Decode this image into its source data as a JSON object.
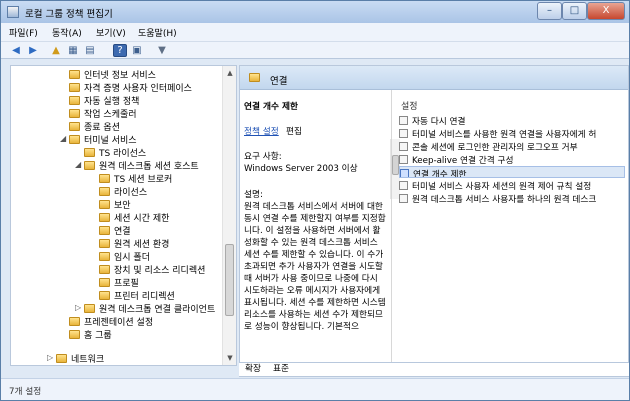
{
  "window": {
    "title": "로컬 그룹 정책 편집기",
    "controls": {
      "minimize": "–",
      "maximize": "□",
      "close": "X"
    }
  },
  "menu": [
    "파일(F)",
    "동작(A)",
    "보기(V)",
    "도움말(H)"
  ],
  "toolbar": {
    "back": "◀",
    "forward": "▶",
    "up": "▲",
    "show_hide": "▦",
    "properties": "▤",
    "help": "?",
    "view": "▣",
    "filter": "▼"
  },
  "tree": [
    {
      "label": "인터넷 정보 서비스",
      "expander": ""
    },
    {
      "label": "자격 증명 사용자 인터페이스",
      "expander": ""
    },
    {
      "label": "자동 실행 정책",
      "expander": ""
    },
    {
      "label": "작업 스케줄러",
      "expander": ""
    },
    {
      "label": "종료 옵션",
      "expander": ""
    },
    {
      "label": "터미널 서비스",
      "expander": "◢"
    },
    {
      "label": "TS 라이선스",
      "expander": ""
    },
    {
      "label": "원격 데스크톱 세션 호스트",
      "expander": "◢"
    },
    {
      "label": "TS 세션 브로커",
      "expander": ""
    },
    {
      "label": "라이선스",
      "expander": ""
    },
    {
      "label": "보안",
      "expander": ""
    },
    {
      "label": "세션 시간 제한",
      "expander": ""
    },
    {
      "label": "연결",
      "expander": ""
    },
    {
      "label": "원격 세션 환경",
      "expander": ""
    },
    {
      "label": "임시 폴더",
      "expander": ""
    },
    {
      "label": "장치 및 리소스 리디렉션",
      "expander": ""
    },
    {
      "label": "프로필",
      "expander": ""
    },
    {
      "label": "프린터 리디렉션",
      "expander": ""
    },
    {
      "label": "원격 데스크톱 연결 클라이언트",
      "expander": "▷"
    },
    {
      "label": "프레젠테이션 설정",
      "expander": ""
    },
    {
      "label": "홈 그룹",
      "expander": ""
    },
    {
      "label": "네트워크",
      "expander": "▷"
    }
  ],
  "scroll": {
    "up": "▲",
    "down": "▼"
  },
  "pane": {
    "header": "연결",
    "description": {
      "title": "연결 개수 제한",
      "edit_link": "정책 설정",
      "edit_rest": "편집",
      "requirements_label": "요구 사항:",
      "requirements_value": "Windows Server 2003 이상",
      "desc_label": "설명:",
      "body": "원격 데스크톱 서비스에서 서버에 대한 동시 연결 수를 제한할지 여부를 지정합니다. 이 설정을 사용하면 서버에서 활성화할 수 있는 원격 데스크톱 서비스 세션 수를 제한할 수 있습니다. 이 수가 초과되면 추가 사용자가 연결을 시도할 때 서버가 사용 중이므로 나중에 다시 시도하라는 오류 메시지가 사용자에게 표시됩니다. 세션 수를 제한하면 시스템 리소스를 사용하는 세션 수가 제한되므로 성능이 향상됩니다. 기본적으"
    },
    "settings_header": "설정",
    "settings": [
      "자동 다시 연결",
      "터미널 서비스를 사용한 원격 연결을 사용자에게 허",
      "콘솔 세션에 로그인한 관리자의 로그오프 거부",
      "Keep-alive 연결 간격 구성",
      "연결 개수 제한",
      "터미널 서비스 사용자 세션의 원격 제어 규칙 설정",
      "원격 데스크톱 서비스 사용자를 하나의 원격 데스크"
    ],
    "selected_setting": 4,
    "tabs": [
      "확장",
      "표준"
    ]
  },
  "status": "7개 설정",
  "colors": {
    "title_bar": "#aac4e6",
    "selected_row": "#dbe7f6",
    "link": "#1f52b5",
    "folder": "#e8b43b"
  }
}
